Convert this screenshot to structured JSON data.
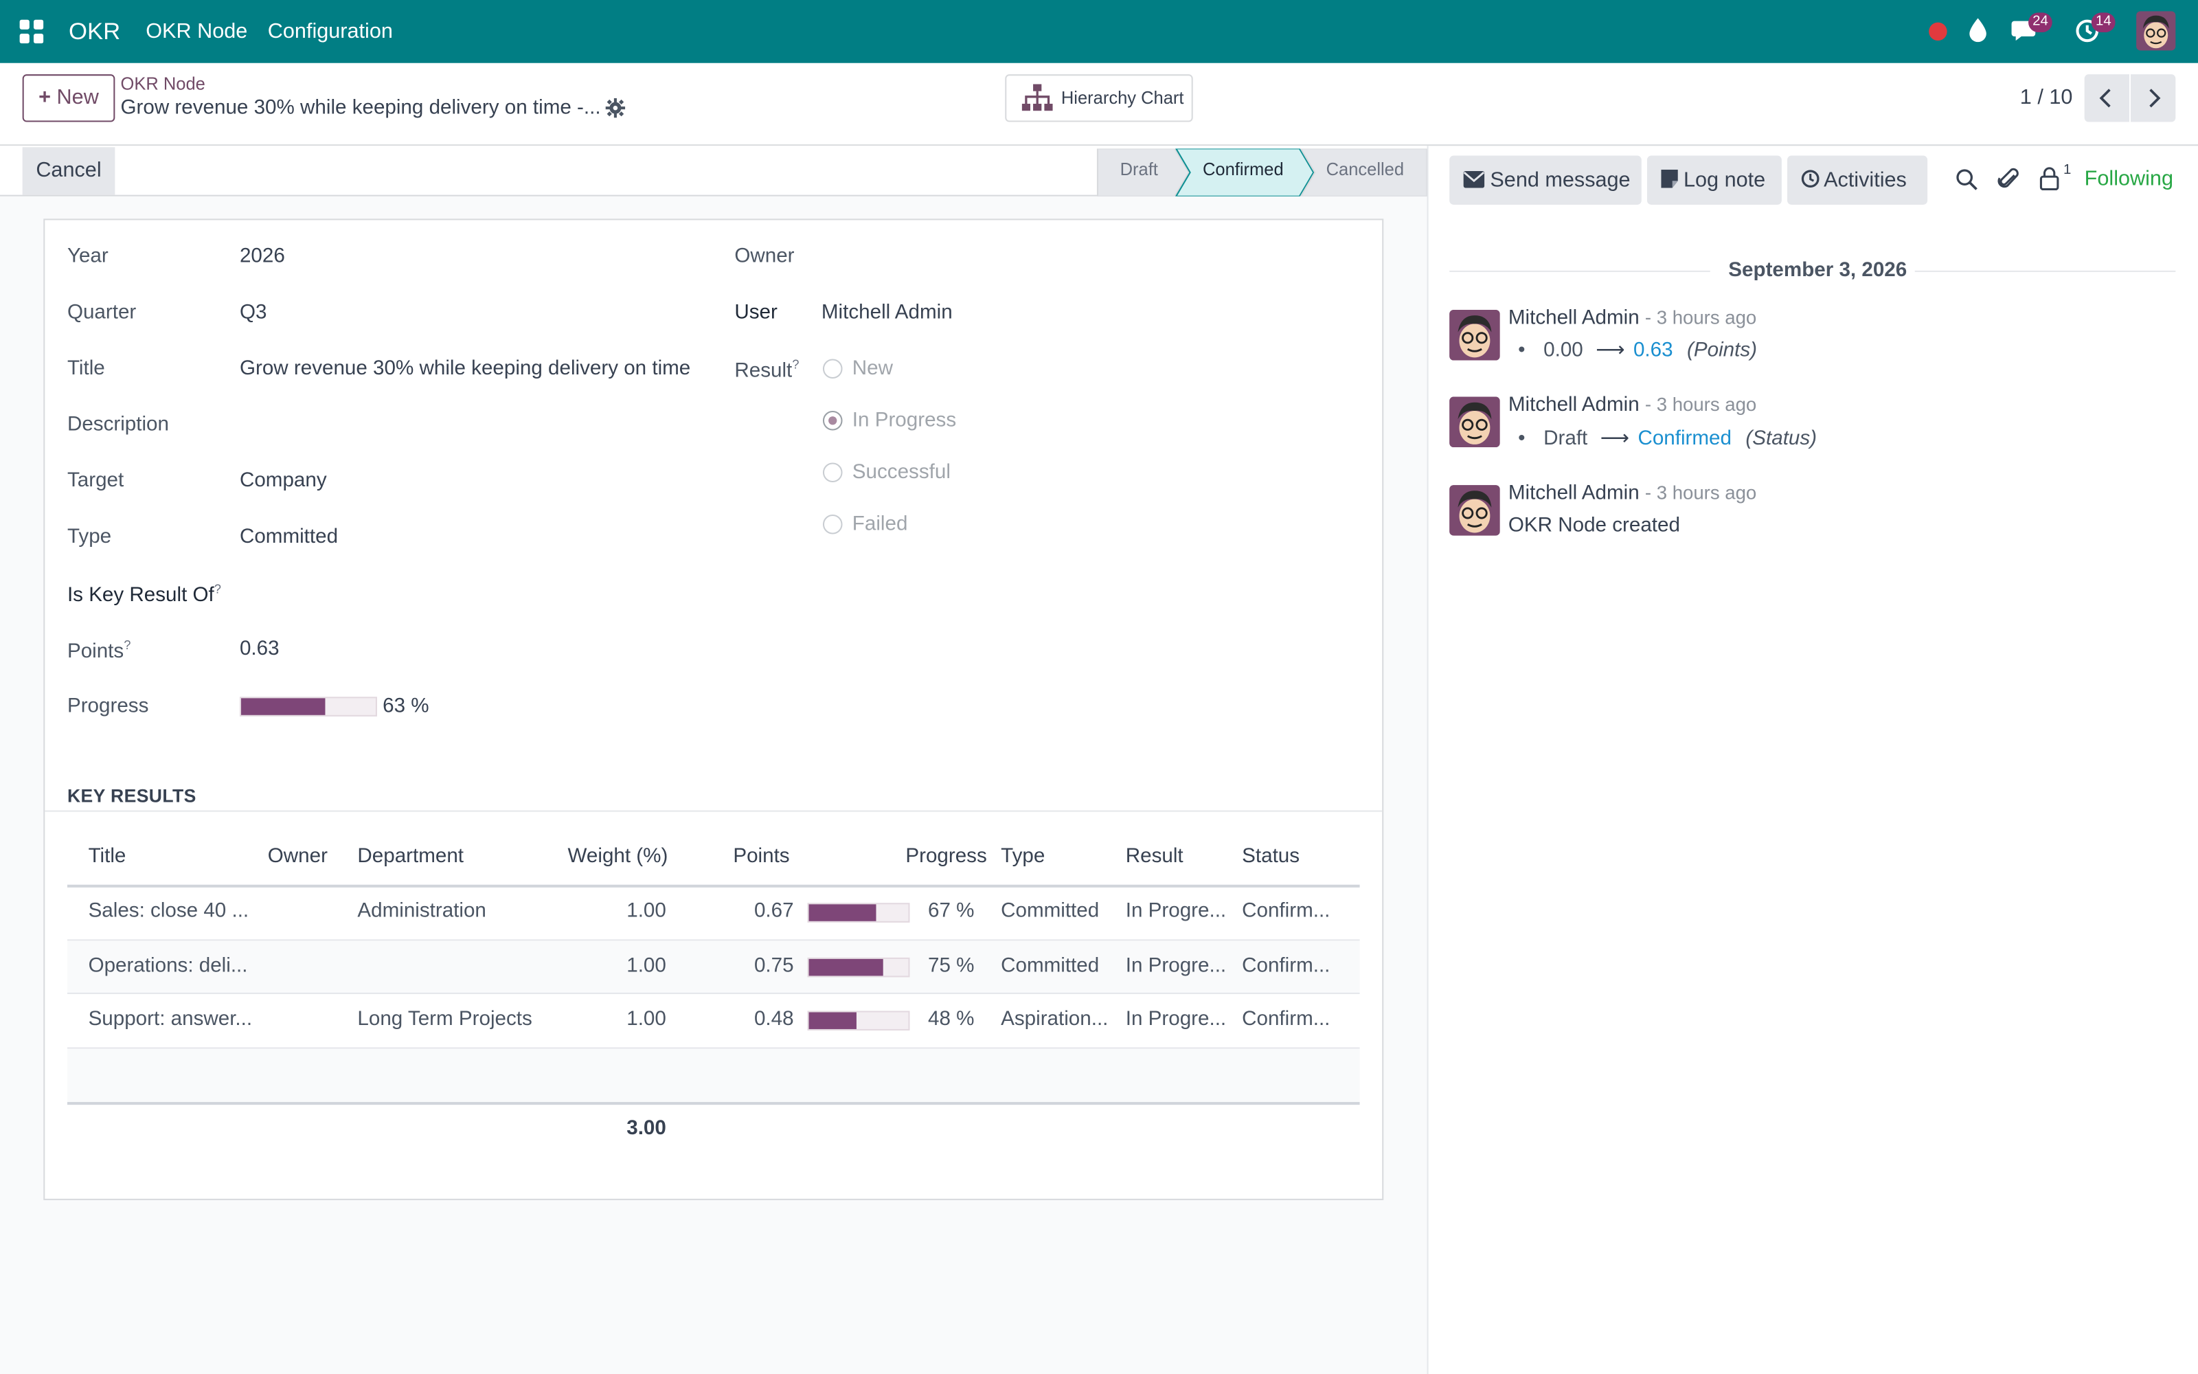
{
  "topbar": {
    "app_name": "OKR",
    "menu": [
      "OKR Node",
      "Configuration"
    ],
    "messages_count": "24",
    "activities_count": "14",
    "colors": {
      "bar": "#017e84",
      "badge": "#8f2f6f"
    }
  },
  "control_panel": {
    "new_label": "New",
    "breadcrumb_parent": "OKR Node",
    "record_title": "Grow revenue 30% while keeping delivery on time -...",
    "hierarchy_chart_label": "Hierarchy Chart",
    "pager": "1 / 10"
  },
  "statusbar": {
    "cancel_label": "Cancel",
    "stages": [
      "Draft",
      "Confirmed",
      "Cancelled"
    ],
    "active_stage": "Confirmed"
  },
  "form": {
    "year": {
      "label": "Year",
      "value": "2026"
    },
    "quarter": {
      "label": "Quarter",
      "value": "Q3"
    },
    "title": {
      "label": "Title",
      "value": "Grow revenue 30% while keeping delivery on time"
    },
    "description": {
      "label": "Description",
      "value": ""
    },
    "target": {
      "label": "Target",
      "value": "Company"
    },
    "type": {
      "label": "Type",
      "value": "Committed"
    },
    "key_result_of": {
      "label": "Is Key Result Of",
      "help": "?"
    },
    "points": {
      "label": "Points",
      "help": "?",
      "value": "0.63"
    },
    "progress": {
      "label": "Progress",
      "value": 63,
      "text": "63 %"
    },
    "owner": {
      "label": "Owner"
    },
    "user": {
      "label": "User",
      "value": "Mitchell Admin"
    },
    "result": {
      "label": "Result",
      "help": "?",
      "options": [
        "New",
        "In Progress",
        "Successful",
        "Failed"
      ],
      "selected": "In Progress"
    }
  },
  "key_results": {
    "section_title": "KEY RESULTS",
    "columns": [
      "Title",
      "Owner",
      "Department",
      "Weight (%)",
      "Points",
      "Progress",
      "Type",
      "Result",
      "Status"
    ],
    "rows": [
      {
        "title": "Sales: close 40 ...",
        "owner": "",
        "department": "Administration",
        "weight": "1.00",
        "points": "0.67",
        "progress": 67,
        "progress_text": "67 %",
        "type": "Committed",
        "result": "In Progre...",
        "status": "Confirm..."
      },
      {
        "title": "Operations: deli...",
        "owner": "",
        "department": "",
        "weight": "1.00",
        "points": "0.75",
        "progress": 75,
        "progress_text": "75 %",
        "type": "Committed",
        "result": "In Progre...",
        "status": "Confirm..."
      },
      {
        "title": "Support: answer...",
        "owner": "",
        "department": "Long Term Projects",
        "weight": "1.00",
        "points": "0.48",
        "progress": 48,
        "progress_text": "48 %",
        "type": "Aspiration...",
        "result": "In Progre...",
        "status": "Confirm..."
      }
    ],
    "total_weight": "3.00"
  },
  "chatter": {
    "send_message": "Send message",
    "log_note": "Log note",
    "activities": "Activities",
    "followers_count": "1",
    "following_label": "Following",
    "date_separator": "September 3, 2026",
    "messages": [
      {
        "author": "Mitchell Admin",
        "ago": "- 3 hours ago",
        "old": "0.00",
        "new": "0.63",
        "field": "(Points)"
      },
      {
        "author": "Mitchell Admin",
        "ago": "- 3 hours ago",
        "old": "Draft",
        "new": "Confirmed",
        "field": "(Status)"
      },
      {
        "author": "Mitchell Admin",
        "ago": "- 3 hours ago",
        "body": "OKR Node created"
      }
    ]
  }
}
